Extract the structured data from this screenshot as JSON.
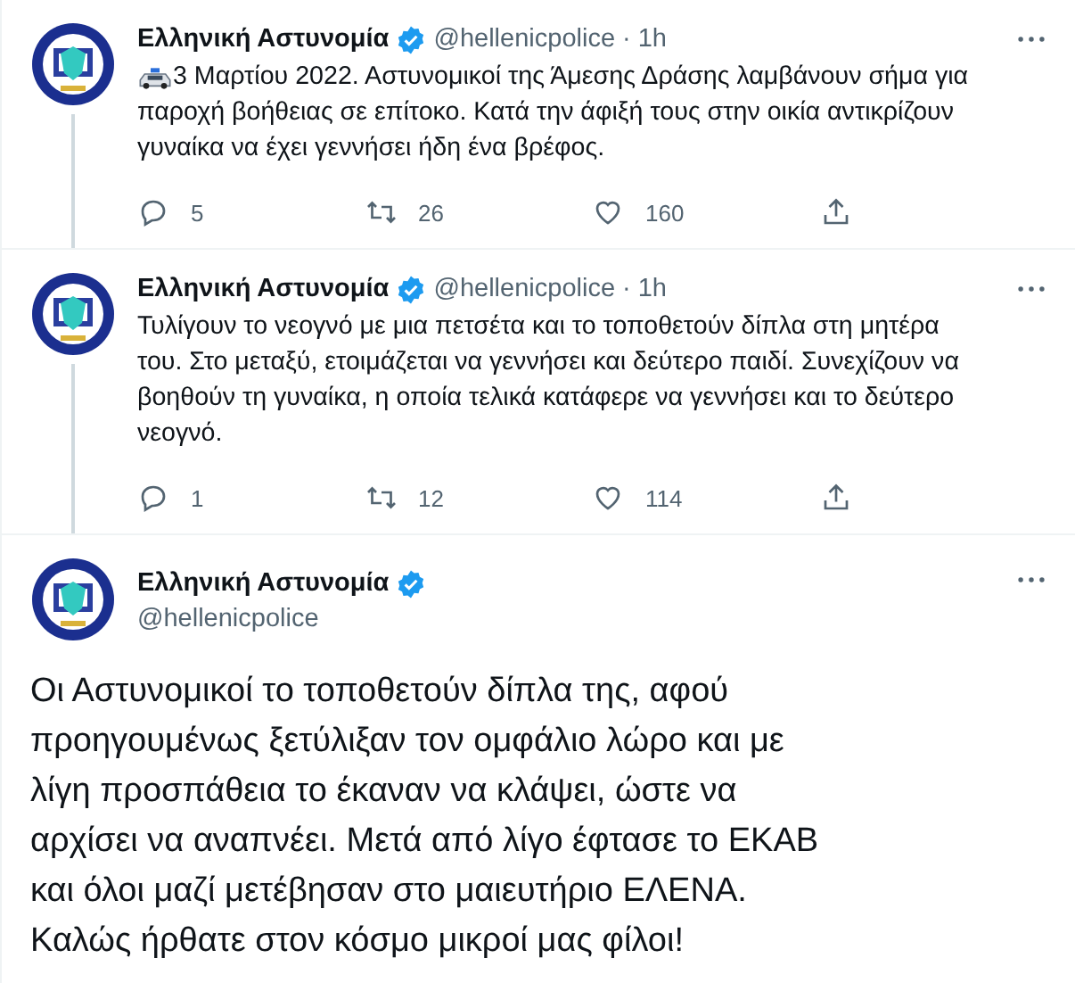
{
  "thread": [
    {
      "author": {
        "name": "Ελληνική Αστυνομία",
        "verified": true,
        "handle": "@hellenicpolice",
        "separator": "·",
        "time": "1h"
      },
      "connector_below": true,
      "car_emoji": true,
      "text_lines": [
        "3 Μαρτίου 2022. Αστυνομικοί της Άμεσης Δράσης λαμβάνουν σήμα για",
        "παροχή βοήθειας σε επίτοκο. Κατά την άφιξή τους στην οικία αντικρίζουν",
        "γυναίκα να έχει γεννήσει ήδη ένα βρέφος."
      ],
      "stats": {
        "replies": "5",
        "retweets": "26",
        "likes": "160"
      }
    },
    {
      "author": {
        "name": "Ελληνική Αστυνομία",
        "verified": true,
        "handle": "@hellenicpolice",
        "separator": "·",
        "time": "1h"
      },
      "connector_below": true,
      "text_lines": [
        "Τυλίγουν το νεογνό με μια πετσέτα και το τοποθετούν δίπλα στη μητέρα",
        "του. Στο μεταξύ, ετοιμάζεται να γεννήσει και δεύτερο παιδί. Συνεχίζουν να",
        "βοηθούν τη γυναίκα, η οποία τελικά κατάφερε να γεννήσει και το δεύτερο",
        "νεογνό."
      ],
      "stats": {
        "replies": "1",
        "retweets": "12",
        "likes": "114"
      }
    }
  ],
  "main_tweet": {
    "author": {
      "name": "Ελληνική Αστυνομία",
      "verified": true,
      "handle": "@hellenicpolice"
    },
    "text_lines": [
      "Οι Αστυνομικοί το τοποθετούν δίπλα της, αφού",
      "προηγουμένως ξετύλιξαν τον ομφάλιο λώρο και με",
      "λίγη προσπάθεια το έκαναν να κλάψει, ώστε να",
      "αρχίσει να αναπνέει. Μετά από λίγο έφτασε το ΕΚΑΒ",
      "και όλοι μαζί μετέβησαν στο μαιευτήριο ΕΛΕΝΑ.",
      "Καλώς ήρθατε στον κόσμο μικροί μας φίλοι!"
    ]
  }
}
